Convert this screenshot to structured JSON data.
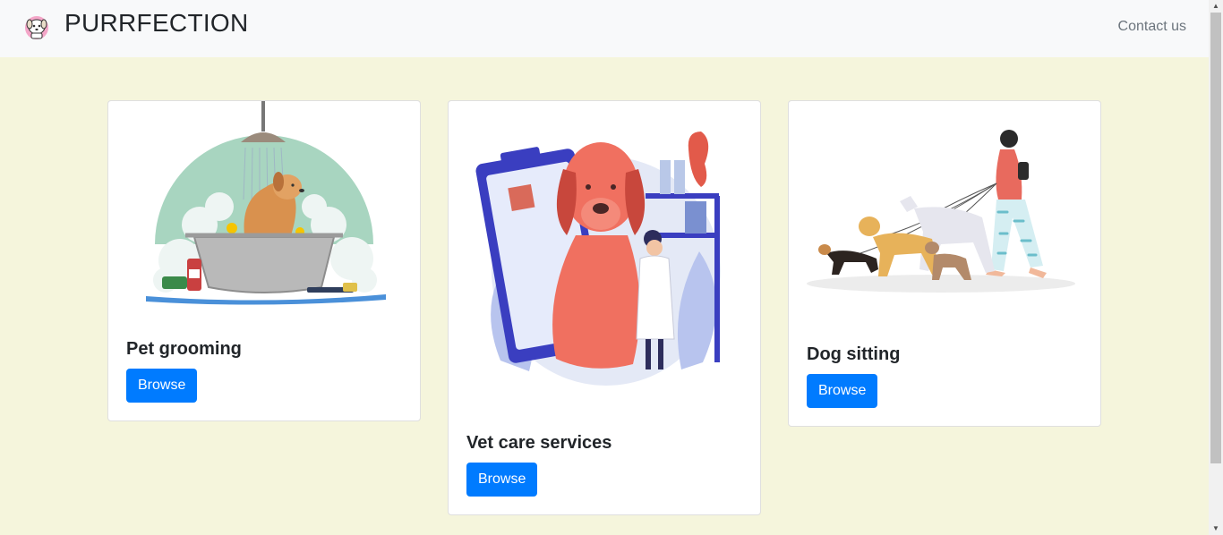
{
  "navbar": {
    "brand": "PURRFECTION",
    "contact_label": "Contact us"
  },
  "cards": [
    {
      "title": "Pet grooming",
      "button": "Browse",
      "image_icon": "dog-bath-illustration"
    },
    {
      "title": "Vet care services",
      "button": "Browse",
      "image_icon": "vet-dog-illustration"
    },
    {
      "title": "Dog sitting",
      "button": "Browse",
      "image_icon": "dog-walker-illustration"
    }
  ],
  "colors": {
    "page_bg": "#f5f5dc",
    "navbar_bg": "#f8f9fa",
    "button_bg": "#007bff"
  }
}
